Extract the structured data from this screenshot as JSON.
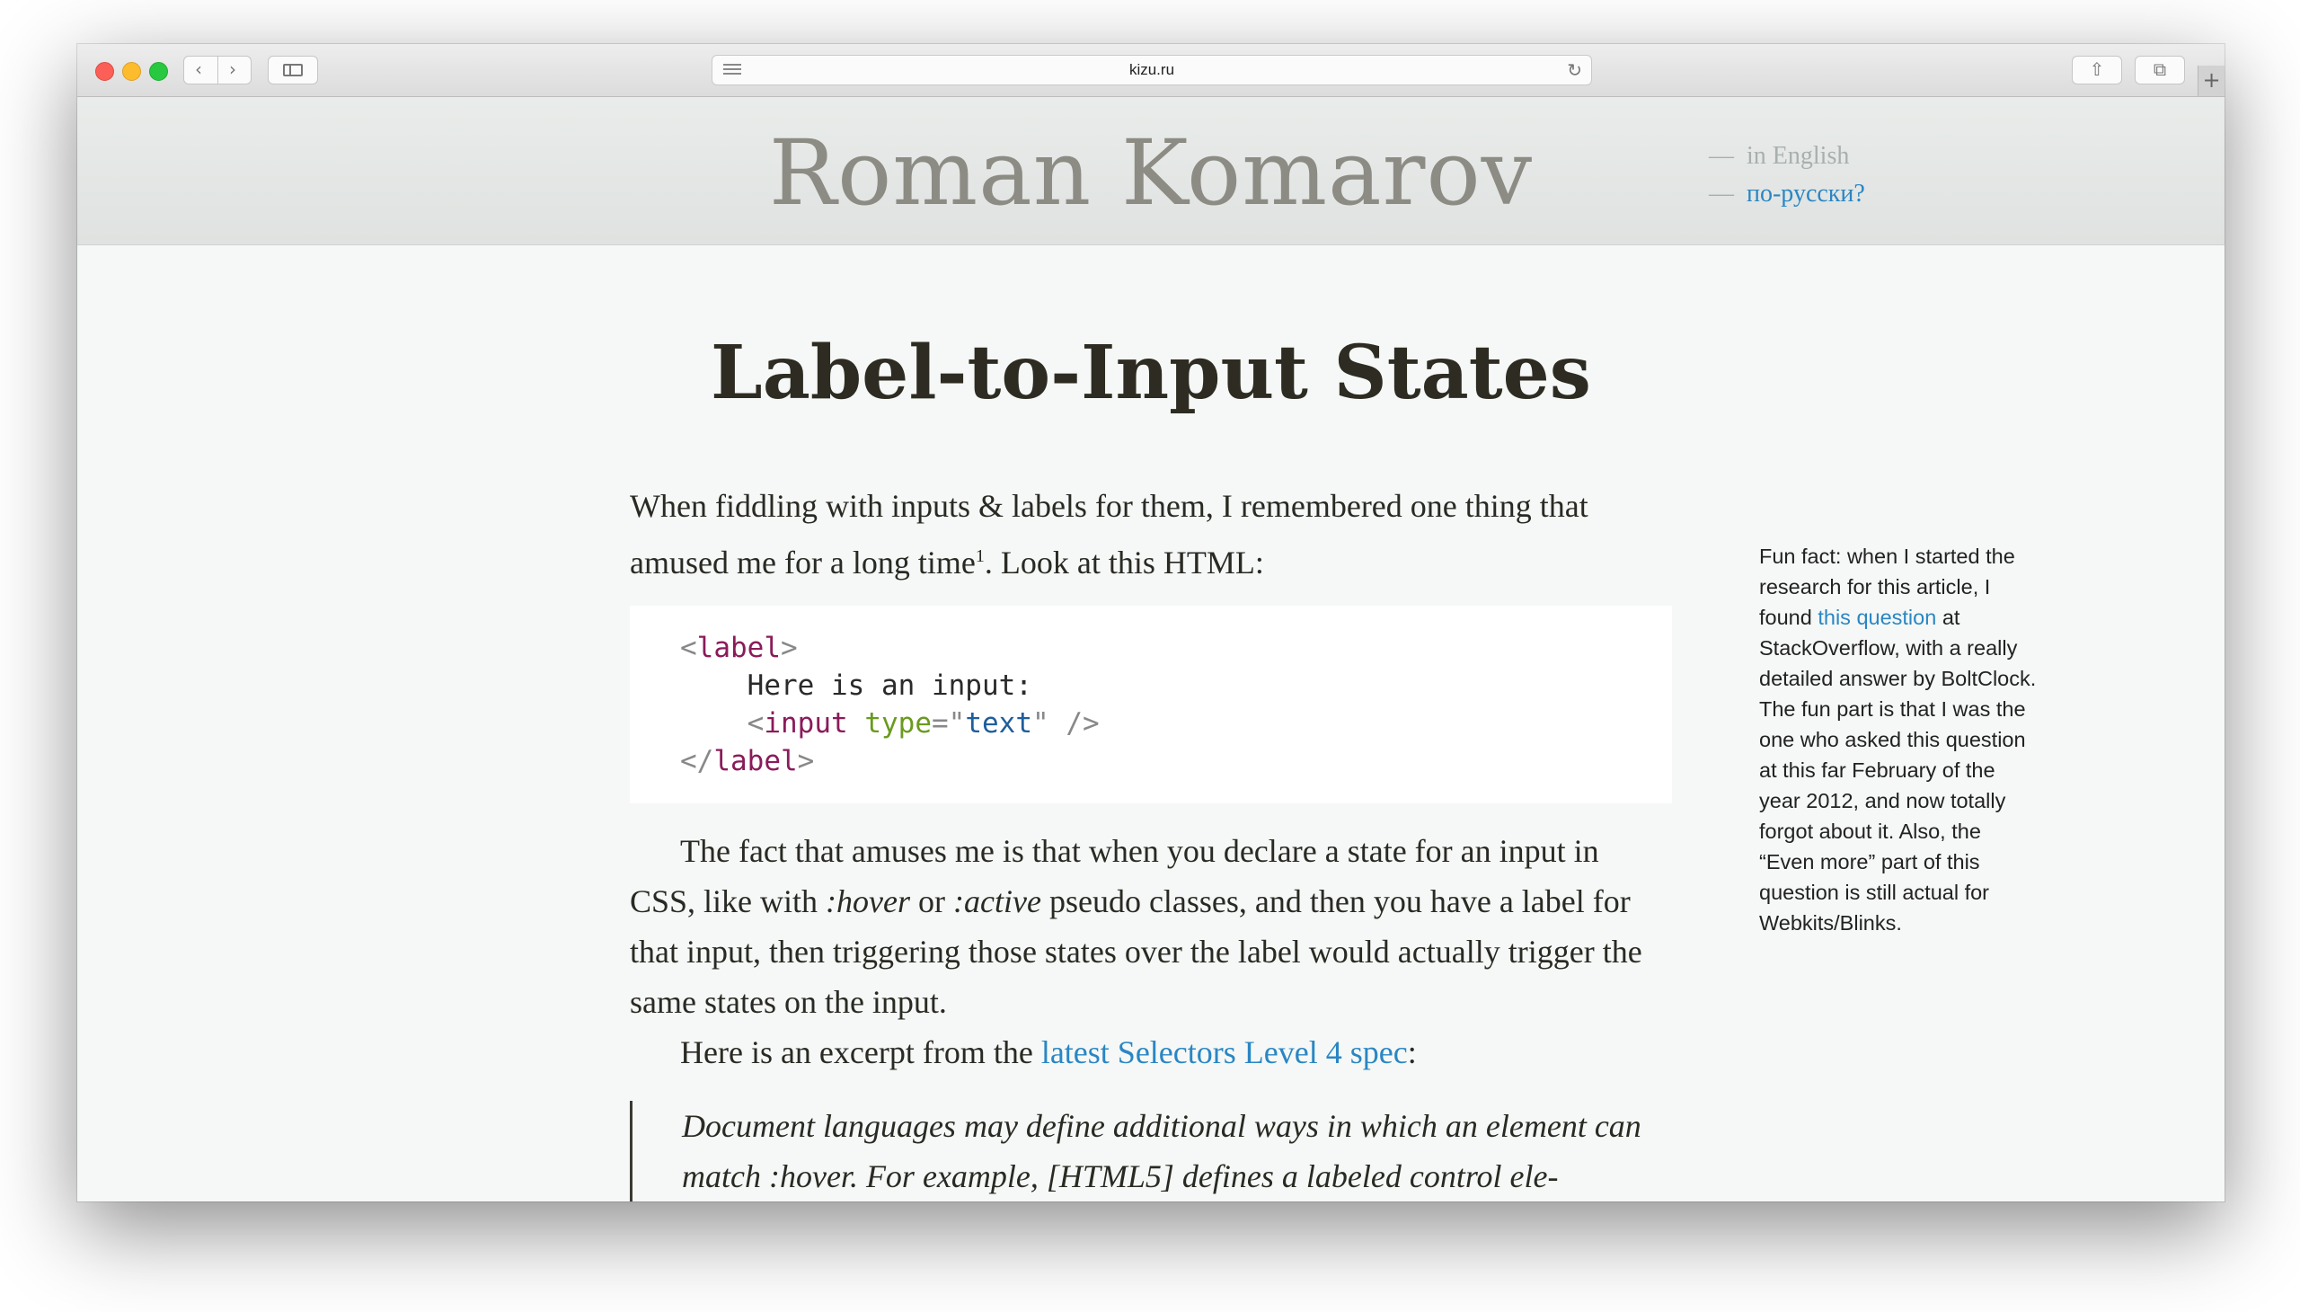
{
  "browser": {
    "url": "kizu.ru",
    "back_icon": "‹",
    "forward_icon": "›",
    "reload_icon": "↻",
    "share_icon": "⇧",
    "tabs_icon": "⧉",
    "newtab_icon": "+"
  },
  "site": {
    "title": "Roman Komarov",
    "lang_dash": "—",
    "lang_en": "in English",
    "lang_ru": "по-русски?"
  },
  "article": {
    "title": "Label-to-Input States",
    "p1_text": "When fiddling with inputs & labels for them, I remembered one thing that amused me for a long time",
    "p1_footnote": "1",
    "p1_tail": ". Look at this HTML:",
    "code": {
      "l1_open": "<",
      "l1_tag": "label",
      "l1_close": ">",
      "l2_text": "Here is an input:",
      "l3_open": "<",
      "l3_tag": "input",
      "l3_attr": "type",
      "l3_eq": "=",
      "l3_q1": "\"",
      "l3_val": "text",
      "l3_q2": "\"",
      "l3_close": " />",
      "l4_open": "</",
      "l4_tag": "label",
      "l4_close": ">"
    },
    "p2_a": "The fact that amuses me is that when you declare a state for an input in CSS, like with ",
    "p2_hover": ":hover",
    "p2_b": " or ",
    "p2_active": ":active",
    "p2_c": " pseudo classes, and then you have a label for that input, then triggering those states over the label would actually trigger the same states on the input.",
    "p3_a": "Here is an excerpt from the ",
    "p3_link": "latest Selectors Level 4 spec",
    "p3_b": ":",
    "quote": "Document languages may define additional ways in which an element can match :hover. For example, [HTML5] defines a labeled control ele-"
  },
  "aside": {
    "a": "Fun fact: when I started the research for this article, I found ",
    "link": "this question",
    "b": " at StackOverflow, with a really detailed answer by BoltClock. The fun part is that I was the one who asked this question at this far February of the year 2012, and now totally forgot about it. Also, the “Even more” part of this question is still actual for Webkits/Blinks."
  }
}
